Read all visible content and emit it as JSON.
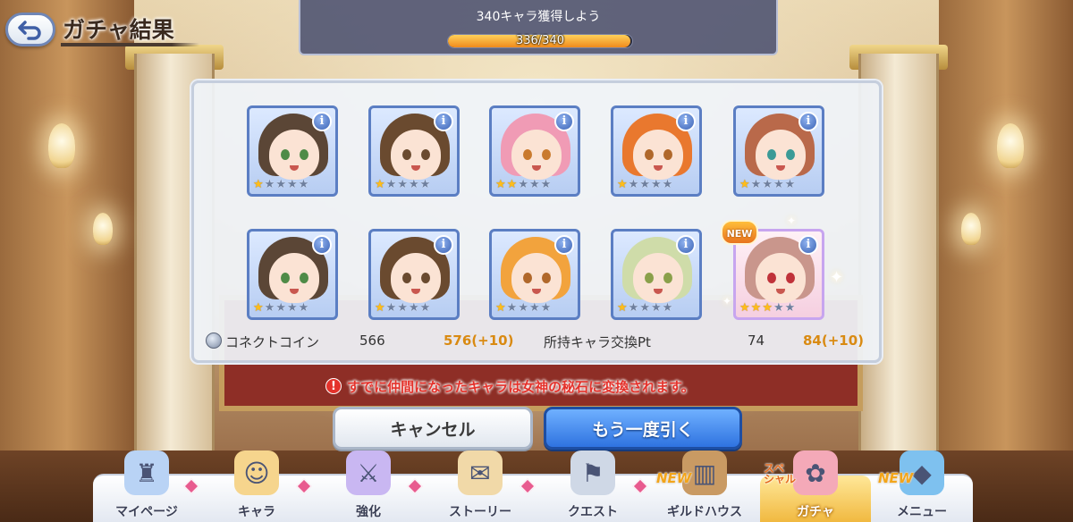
{
  "header": {
    "title": "ガチャ結果",
    "back_icon": "back-arrow-icon"
  },
  "mission": {
    "label": "340キャラ獲得しよう",
    "progress_text": "336/340",
    "progress_fraction": 0.988
  },
  "results": [
    {
      "rarity": 1,
      "hair": "#5b4636",
      "eyes": "#4f8b47",
      "new": false
    },
    {
      "rarity": 1,
      "hair": "#6a4a2f",
      "eyes": "#6a4a2f",
      "new": false
    },
    {
      "rarity": 2,
      "hair": "#f09bb5",
      "eyes": "#c97a2e",
      "new": false
    },
    {
      "rarity": 1,
      "hair": "#e9782e",
      "eyes": "#b0682b",
      "new": false
    },
    {
      "rarity": 1,
      "hair": "#b9694a",
      "eyes": "#3b9a96",
      "new": false
    },
    {
      "rarity": 1,
      "hair": "#5b4636",
      "eyes": "#4f8b47",
      "new": false
    },
    {
      "rarity": 1,
      "hair": "#6a4a2f",
      "eyes": "#6a4a2f",
      "new": false
    },
    {
      "rarity": 1,
      "hair": "#f2a33d",
      "eyes": "#b0682b",
      "new": false
    },
    {
      "rarity": 1,
      "hair": "#cfdca9",
      "eyes": "#8aa04a",
      "new": false
    },
    {
      "rarity": 3,
      "hair": "#c9968c",
      "eyes": "#c0323a",
      "new": true
    }
  ],
  "new_badge": "NEW",
  "stats": {
    "coin_label": "コネクトコイン",
    "coin_before": "566",
    "coin_after": "576(+10)",
    "pt_label": "所持キャラ交換Pt",
    "pt_before": "74",
    "pt_after": "84(+10)"
  },
  "warning": {
    "icon_text": "!",
    "text": "すでに仲間になったキャラは女神の秘石に変換されます。"
  },
  "buttons": {
    "cancel": "キャンセル",
    "again": "もう一度引く"
  },
  "nav": {
    "items": [
      {
        "label": "マイページ",
        "icon": "castle-icon",
        "badge": true,
        "new": false,
        "active": false
      },
      {
        "label": "キャラ",
        "icon": "character-icon",
        "badge": true,
        "new": false,
        "active": false
      },
      {
        "label": "強化",
        "icon": "sword-orbs-icon",
        "badge": true,
        "new": false,
        "active": false
      },
      {
        "label": "ストーリー",
        "icon": "scroll-icon",
        "badge": true,
        "new": false,
        "active": false
      },
      {
        "label": "クエスト",
        "icon": "flag-sword-icon",
        "badge": true,
        "new": false,
        "active": false
      },
      {
        "label": "ギルドハウス",
        "icon": "door-icon",
        "badge": false,
        "new": true,
        "active": false
      },
      {
        "label": "ガチャ",
        "icon": "gacha-icon",
        "badge": false,
        "new": false,
        "active": true
      },
      {
        "label": "メニュー",
        "icon": "crystal-icon",
        "badge": false,
        "new": true,
        "active": false
      }
    ],
    "new_tag": "NEW",
    "special_tag": "スペ\nシャル"
  }
}
